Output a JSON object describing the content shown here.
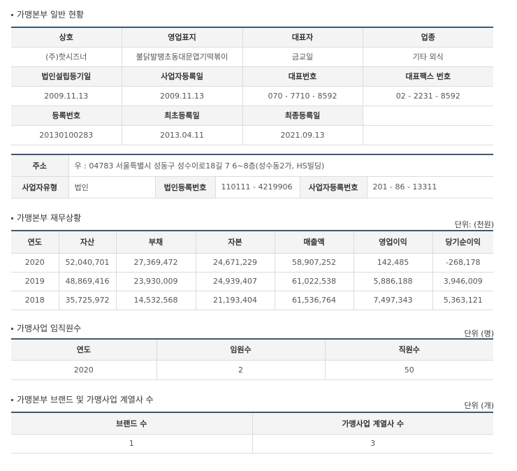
{
  "general": {
    "title": "가맹본부 일반 현황",
    "rows": [
      [
        "상호",
        "영업표지",
        "대표자",
        "업종"
      ],
      [
        "(주)핫시즈너",
        "불닭발땡초동대문엽기떡볶이",
        "금교일",
        "기타 외식"
      ],
      [
        "법인설립등기일",
        "사업자등록일",
        "대표번호",
        "대표팩스 번호"
      ],
      [
        "2009.11.13",
        "2009.11.13",
        "070 - 7710 - 8592",
        "02 - 2231 - 8592"
      ],
      [
        "등록번호",
        "최초등록일",
        "최종등록일",
        ""
      ],
      [
        "20130100283",
        "2013.04.11",
        "2021.09.13",
        ""
      ]
    ]
  },
  "address": {
    "label": "주소",
    "value": "우 : 04783 서울특별시 성동구 성수이로18길 7 6~8층(성수동2가, HS빌딩)",
    "biz_type_label": "사업자유형",
    "biz_type_value": "법인",
    "corp_no_label": "법인등록번호",
    "corp_no_value": "110111 - 4219906",
    "biz_no_label": "사업자등록번호",
    "biz_no_value": "201 - 86 - 13311"
  },
  "finance": {
    "title": "가맹본부 재무상황",
    "unit": "단위: (천원)",
    "headers": [
      "연도",
      "자산",
      "부채",
      "자본",
      "매출액",
      "영업이익",
      "당기순이익"
    ],
    "rows": [
      [
        "2020",
        "52,040,701",
        "27,369,472",
        "24,671,229",
        "58,907,252",
        "142,485",
        "-268,178"
      ],
      [
        "2019",
        "48,869,416",
        "23,930,009",
        "24,939,407",
        "61,022,538",
        "5,886,188",
        "3,946,009"
      ],
      [
        "2018",
        "35,725,972",
        "14,532,568",
        "21,193,404",
        "61,536,764",
        "7,497,343",
        "5,363,121"
      ]
    ]
  },
  "staff": {
    "title": "가맹사업 임직원수",
    "unit": "단위 (명)",
    "headers": [
      "연도",
      "임원수",
      "직원수"
    ],
    "rows": [
      [
        "2020",
        "2",
        "50"
      ]
    ]
  },
  "brands": {
    "title": "가맹본부 브랜드 및 가맹사업 계열사 수",
    "unit": "단위 (개)",
    "headers": [
      "브랜드 수",
      "가맹사업 계열사 수"
    ],
    "rows": [
      [
        "1",
        "3"
      ]
    ]
  }
}
